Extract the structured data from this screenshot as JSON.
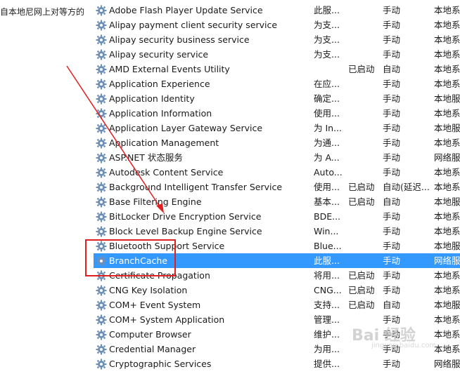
{
  "left_panel": {
    "description": "自本地尼网上对等方的"
  },
  "colors": {
    "selected_row": "#3399ff",
    "annotation": "#e02020",
    "gear_icon": "#6d8fb8"
  },
  "services": [
    {
      "name": "Adobe Flash Player Update Service",
      "description": "此服...",
      "status": "",
      "startup": "手动",
      "logon": "本地系"
    },
    {
      "name": "Alipay payment client security service",
      "description": "为支...",
      "status": "",
      "startup": "手动",
      "logon": "本地系"
    },
    {
      "name": "Alipay security business service",
      "description": "为支...",
      "status": "",
      "startup": "手动",
      "logon": "本地系"
    },
    {
      "name": "Alipay security service",
      "description": "为支...",
      "status": "",
      "startup": "手动",
      "logon": "本地系"
    },
    {
      "name": "AMD External Events Utility",
      "description": "",
      "status": "已启动",
      "startup": "自动",
      "logon": "本地系"
    },
    {
      "name": "Application Experience",
      "description": "在应...",
      "status": "",
      "startup": "手动",
      "logon": "本地系"
    },
    {
      "name": "Application Identity",
      "description": "确定...",
      "status": "",
      "startup": "手动",
      "logon": "本地服"
    },
    {
      "name": "Application Information",
      "description": "使用...",
      "status": "",
      "startup": "手动",
      "logon": "本地系"
    },
    {
      "name": "Application Layer Gateway Service",
      "description": "为 In...",
      "status": "",
      "startup": "手动",
      "logon": "本地服"
    },
    {
      "name": "Application Management",
      "description": "为通...",
      "status": "",
      "startup": "手动",
      "logon": "本地系"
    },
    {
      "name": "ASP.NET 状态服务",
      "description": "为 A...",
      "status": "",
      "startup": "手动",
      "logon": "网络服"
    },
    {
      "name": "Autodesk Content Service",
      "description": "Auto...",
      "status": "",
      "startup": "手动",
      "logon": "本地系"
    },
    {
      "name": "Background Intelligent Transfer Service",
      "description": "使用...",
      "status": "已启动",
      "startup": "自动(延迟...",
      "logon": "本地系"
    },
    {
      "name": "Base Filtering Engine",
      "description": "基本...",
      "status": "已启动",
      "startup": "自动",
      "logon": "本地服"
    },
    {
      "name": "BitLocker Drive Encryption Service",
      "description": "BDE...",
      "status": "",
      "startup": "手动",
      "logon": "本地系"
    },
    {
      "name": "Block Level Backup Engine Service",
      "description": "Win...",
      "status": "",
      "startup": "手动",
      "logon": "本地系"
    },
    {
      "name": "Bluetooth Support Service",
      "description": "Blue...",
      "status": "",
      "startup": "手动",
      "logon": "本地服"
    },
    {
      "name": "BranchCache",
      "description": "此服...",
      "status": "",
      "startup": "手动",
      "logon": "网络服",
      "selected": true
    },
    {
      "name": "Certificate Propagation",
      "description": "将用...",
      "status": "已启动",
      "startup": "手动",
      "logon": "本地系"
    },
    {
      "name": "CNG Key Isolation",
      "description": "CNG...",
      "status": "已启动",
      "startup": "手动",
      "logon": "本地系"
    },
    {
      "name": "COM+ Event System",
      "description": "支持...",
      "status": "已启动",
      "startup": "自动",
      "logon": "本地服"
    },
    {
      "name": "COM+ System Application",
      "description": "管理...",
      "status": "",
      "startup": "手动",
      "logon": "本地系"
    },
    {
      "name": "Computer Browser",
      "description": "维护...",
      "status": "",
      "startup": "手动",
      "logon": "本地系"
    },
    {
      "name": "Credential Manager",
      "description": "为用...",
      "status": "",
      "startup": "手动",
      "logon": "本地系"
    },
    {
      "name": "Cryptographic Services",
      "description": "提供...",
      "status": "",
      "startup": "手动",
      "logon": "网络服"
    }
  ],
  "watermark": {
    "text": "Bai 经验",
    "sub": "jingyan.baidu.com"
  }
}
